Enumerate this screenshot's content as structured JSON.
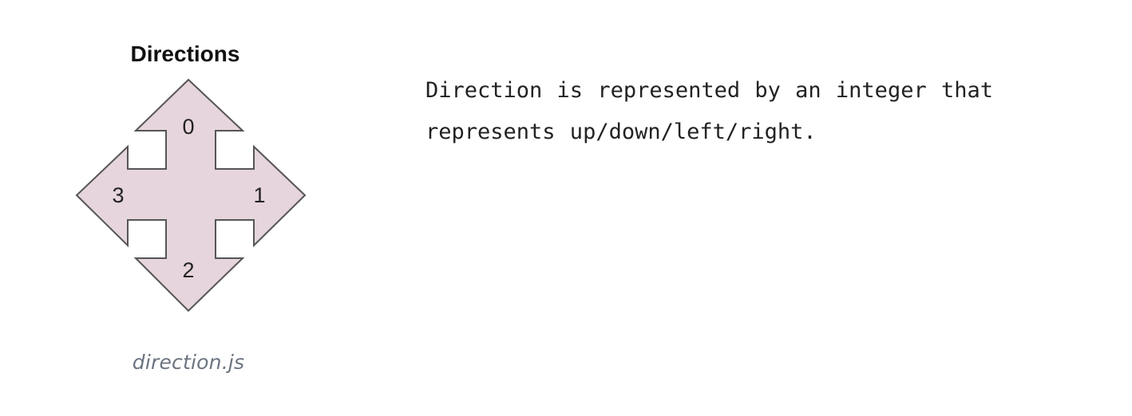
{
  "diagram": {
    "title": "Directions",
    "fill_color": "#e6d5dc",
    "stroke_color": "#555555",
    "labels": {
      "up": "0",
      "right": "1",
      "down": "2",
      "left": "3"
    }
  },
  "caption": "direction.js",
  "description": "Direction is represented by an integer that represents up/down/left/right."
}
